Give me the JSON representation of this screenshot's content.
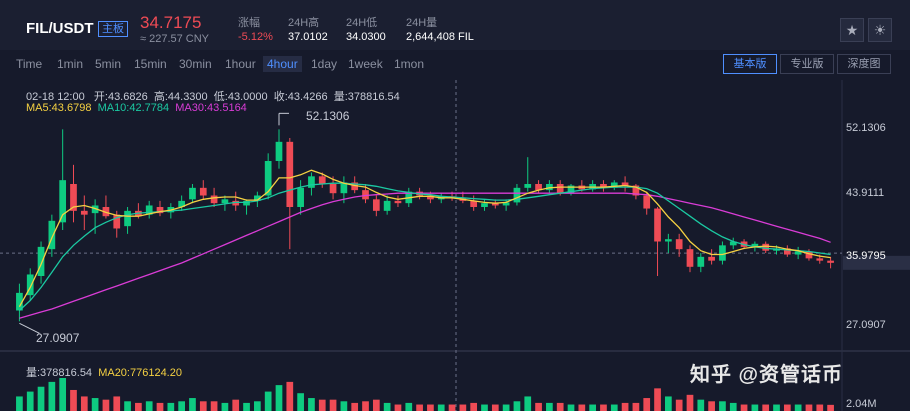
{
  "header": {
    "pair": "FIL/USDT",
    "badge": "主板",
    "price": "34.7175",
    "price_cny": "≈ 227.57 CNY",
    "change_label": "涨幅",
    "change_value": "-5.12%",
    "high_label": "24H高",
    "high_value": "37.0102",
    "low_label": "24H低",
    "low_value": "34.0300",
    "vol_label": "24H量",
    "vol_value": "2,644,408 FIL",
    "icons": [
      "star-icon",
      "sun-icon"
    ]
  },
  "timeframes": [
    "Time",
    "1min",
    "5min",
    "15min",
    "30min",
    "1hour",
    "4hour",
    "1day",
    "1week",
    "1mon"
  ],
  "active_timeframe": "4hour",
  "view_buttons": [
    "基本版",
    "专业版",
    "深度图"
  ],
  "active_view": "基本版",
  "ohlc": {
    "date": "02-18 12:00",
    "open": "开:43.6826",
    "high": "高:44.3300",
    "low": "低:43.0000",
    "close": "收:43.4266",
    "volume": "量:378816.54"
  },
  "ma": {
    "ma5": "MA5:43.6798",
    "ma10": "MA10:42.7784",
    "ma30": "MA30:43.5164"
  },
  "volume_panel": {
    "vol": "量:378816.54",
    "ma20": "MA20:776124.20",
    "axis_label": "2.04M"
  },
  "watermark": "知乎 @资管话币",
  "colors": {
    "up": "#0ecb81",
    "down": "#ef4b55",
    "ma5": "#f5d142",
    "ma10": "#1bc9a2",
    "ma30": "#d93cd6",
    "accent": "#4f8fff"
  },
  "chart_data": {
    "type": "candlestick",
    "y_ticks": [
      "52.1306",
      "43.9111",
      "35.9795",
      "27.0907"
    ],
    "ylim": [
      24.0,
      57.0
    ],
    "marked_high": "52.1306",
    "marked_low": "27.0907",
    "crosshair_value": "35.9795",
    "grid": false,
    "candles": [
      [
        28.5,
        32.0,
        27.0907,
        30.8
      ],
      [
        30.5,
        34.0,
        29.8,
        33.2
      ],
      [
        33.0,
        37.5,
        32.0,
        36.8
      ],
      [
        36.5,
        41.0,
        35.5,
        40.2
      ],
      [
        40.0,
        52.1306,
        39.0,
        45.5
      ],
      [
        45.0,
        47.5,
        40.0,
        41.5
      ],
      [
        41.5,
        43.5,
        39.0,
        41.0
      ],
      [
        41.2,
        43.0,
        38.5,
        42.2
      ],
      [
        42.0,
        43.5,
        40.5,
        40.8
      ],
      [
        41.0,
        41.5,
        38.0,
        39.2
      ],
      [
        39.5,
        42.0,
        38.5,
        41.5
      ],
      [
        41.5,
        42.5,
        40.5,
        40.8
      ],
      [
        41.0,
        42.8,
        40.5,
        42.2
      ],
      [
        42.0,
        42.8,
        40.8,
        41.2
      ],
      [
        41.3,
        42.5,
        40.5,
        42.0
      ],
      [
        42.0,
        43.5,
        41.5,
        42.8
      ],
      [
        43.0,
        45.0,
        42.5,
        44.5
      ],
      [
        44.5,
        45.5,
        43.0,
        43.5
      ],
      [
        43.5,
        44.5,
        42.0,
        42.5
      ],
      [
        42.5,
        43.5,
        41.5,
        43.0
      ],
      [
        42.8,
        44.0,
        41.5,
        42.2
      ],
      [
        42.2,
        43.0,
        41.0,
        42.8
      ],
      [
        42.8,
        44.0,
        42.0,
        43.5
      ],
      [
        43.5,
        49.0,
        43.0,
        48.0
      ],
      [
        48.0,
        52.1306,
        47.0,
        50.5
      ],
      [
        50.5,
        51.0,
        36.5,
        42.0
      ],
      [
        42.0,
        45.5,
        41.0,
        44.5
      ],
      [
        44.5,
        46.5,
        43.5,
        46.0
      ],
      [
        46.0,
        46.5,
        44.5,
        45.0
      ],
      [
        45.0,
        46.0,
        43.0,
        43.8
      ],
      [
        43.8,
        46.0,
        42.5,
        45.2
      ],
      [
        45.2,
        46.0,
        43.8,
        44.2
      ],
      [
        44.2,
        45.0,
        42.5,
        43.0
      ],
      [
        43.0,
        43.5,
        40.8,
        41.5
      ],
      [
        41.5,
        43.5,
        41.0,
        42.8
      ],
      [
        42.8,
        43.5,
        42.0,
        42.5
      ],
      [
        42.5,
        44.5,
        42.0,
        44.0
      ],
      [
        44.0,
        44.5,
        43.0,
        43.5
      ],
      [
        43.5,
        44.0,
        42.5,
        43.0
      ],
      [
        43.0,
        43.8,
        42.5,
        43.4
      ],
      [
        43.4,
        44.0,
        42.8,
        43.2
      ],
      [
        43.2,
        44.0,
        42.5,
        42.8
      ],
      [
        42.8,
        43.5,
        41.5,
        42.0
      ],
      [
        42.0,
        43.0,
        41.5,
        42.5
      ],
      [
        42.5,
        43.0,
        41.8,
        42.2
      ],
      [
        42.2,
        43.0,
        41.5,
        42.6
      ],
      [
        42.6,
        45.0,
        42.2,
        44.5
      ],
      [
        44.5,
        48.5,
        44.0,
        45.0
      ],
      [
        45.0,
        45.5,
        43.8,
        44.2
      ],
      [
        44.2,
        45.5,
        43.8,
        45.0
      ],
      [
        45.0,
        45.5,
        43.5,
        43.8
      ],
      [
        43.8,
        45.0,
        43.5,
        44.8
      ],
      [
        44.8,
        45.5,
        44.0,
        44.3
      ],
      [
        44.3,
        45.5,
        44.0,
        45.0
      ],
      [
        45.0,
        45.5,
        44.0,
        44.5
      ],
      [
        44.5,
        45.5,
        44.2,
        45.2
      ],
      [
        45.2,
        46.0,
        44.0,
        44.8
      ],
      [
        44.8,
        45.0,
        43.0,
        43.5
      ],
      [
        43.5,
        44.0,
        41.0,
        41.8
      ],
      [
        41.8,
        42.0,
        33.0,
        37.5
      ],
      [
        37.5,
        38.5,
        36.0,
        37.8
      ],
      [
        37.8,
        38.5,
        35.5,
        36.5
      ],
      [
        36.5,
        37.0,
        33.5,
        34.2
      ],
      [
        34.2,
        36.0,
        33.5,
        35.5
      ],
      [
        35.5,
        36.5,
        34.5,
        35.0
      ],
      [
        35.0,
        37.5,
        34.5,
        37.0
      ],
      [
        37.0,
        38.0,
        36.5,
        37.5
      ],
      [
        37.5,
        37.8,
        36.5,
        36.8
      ],
      [
        36.8,
        37.5,
        36.2,
        37.2
      ],
      [
        37.2,
        37.5,
        36.0,
        36.3
      ],
      [
        36.3,
        37.0,
        35.8,
        36.6
      ],
      [
        36.6,
        37.0,
        35.5,
        35.8
      ],
      [
        35.8,
        36.8,
        35.2,
        36.2
      ],
      [
        36.2,
        36.5,
        35.0,
        35.3
      ],
      [
        35.3,
        35.8,
        34.6,
        35.0
      ],
      [
        35.0,
        35.5,
        34.0,
        34.7175
      ]
    ],
    "ma5": [
      29.0,
      31.5,
      34.5,
      38.0,
      41.0,
      42.0,
      42.2,
      41.8,
      41.3,
      40.9,
      40.8,
      40.8,
      41.1,
      41.4,
      41.6,
      42.0,
      42.6,
      43.0,
      43.2,
      43.3,
      43.3,
      42.9,
      42.9,
      44.0,
      45.8,
      45.8,
      46.2,
      46.8,
      46.3,
      45.6,
      45.1,
      44.8,
      44.6,
      43.9,
      43.3,
      43.0,
      43.2,
      43.4,
      43.4,
      43.2,
      43.2,
      43.0,
      42.8,
      42.6,
      42.5,
      42.6,
      43.2,
      43.8,
      44.2,
      44.5,
      44.6,
      44.6,
      44.6,
      44.6,
      44.6,
      44.7,
      44.8,
      44.6,
      43.9,
      42.4,
      40.7,
      39.3,
      37.5,
      36.3,
      35.8,
      35.8,
      36.2,
      36.6,
      36.8,
      36.9,
      36.8,
      36.5,
      36.3,
      35.9,
      35.6,
      35.4
    ],
    "ma10": [
      28.5,
      29.8,
      31.5,
      33.5,
      35.5,
      37.0,
      38.2,
      39.3,
      40.0,
      40.6,
      41.0,
      41.2,
      41.3,
      41.4,
      41.5,
      41.6,
      41.8,
      42.0,
      42.2,
      42.4,
      42.6,
      42.6,
      42.8,
      43.2,
      43.8,
      44.2,
      44.6,
      44.9,
      45.0,
      45.1,
      45.1,
      45.0,
      44.9,
      44.7,
      44.4,
      44.1,
      43.9,
      43.7,
      43.6,
      43.4,
      43.3,
      43.2,
      43.1,
      43.0,
      42.9,
      42.9,
      43.0,
      43.2,
      43.4,
      43.6,
      43.8,
      44.0,
      44.2,
      44.4,
      44.5,
      44.6,
      44.6,
      44.6,
      44.4,
      43.8,
      42.8,
      41.8,
      40.8,
      39.8,
      38.9,
      38.1,
      37.5,
      37.1,
      36.8,
      36.6,
      36.5,
      36.4,
      36.3,
      36.2,
      36.0,
      35.8
    ],
    "ma30": [
      27.5,
      27.9,
      28.3,
      28.7,
      29.2,
      29.7,
      30.2,
      30.7,
      31.2,
      31.7,
      32.2,
      32.7,
      33.2,
      33.7,
      34.2,
      34.7,
      35.3,
      35.9,
      36.5,
      37.1,
      37.7,
      38.3,
      38.9,
      39.5,
      40.1,
      40.7,
      41.3,
      41.8,
      42.3,
      42.7,
      43.0,
      43.3,
      43.5,
      43.6,
      43.7,
      43.8,
      43.8,
      43.8,
      43.8,
      43.8,
      43.8,
      43.8,
      43.8,
      43.8,
      43.8,
      43.8,
      43.8,
      43.8,
      43.8,
      43.8,
      43.8,
      43.8,
      43.8,
      43.8,
      43.8,
      43.8,
      43.8,
      43.7,
      43.6,
      43.4,
      43.1,
      42.8,
      42.5,
      42.2,
      41.9,
      41.5,
      41.1,
      40.7,
      40.3,
      39.9,
      39.5,
      39.1,
      38.7,
      38.3,
      37.9,
      37.4
    ],
    "volume": [
      0.9,
      1.2,
      1.5,
      1.8,
      2.04,
      1.3,
      0.9,
      0.8,
      0.7,
      0.9,
      0.6,
      0.5,
      0.6,
      0.5,
      0.5,
      0.6,
      0.8,
      0.6,
      0.6,
      0.5,
      0.7,
      0.5,
      0.6,
      1.2,
      1.6,
      1.8,
      1.1,
      0.8,
      0.7,
      0.7,
      0.6,
      0.5,
      0.6,
      0.7,
      0.5,
      0.4,
      0.5,
      0.4,
      0.4,
      0.4,
      0.4,
      0.4,
      0.5,
      0.4,
      0.4,
      0.4,
      0.6,
      0.9,
      0.5,
      0.5,
      0.5,
      0.4,
      0.4,
      0.4,
      0.4,
      0.4,
      0.5,
      0.5,
      0.8,
      1.4,
      0.9,
      0.7,
      1.0,
      0.7,
      0.6,
      0.6,
      0.5,
      0.4,
      0.4,
      0.4,
      0.4,
      0.4,
      0.4,
      0.4,
      0.4,
      0.38
    ],
    "vol_ylim": [
      0,
      2.04
    ]
  }
}
